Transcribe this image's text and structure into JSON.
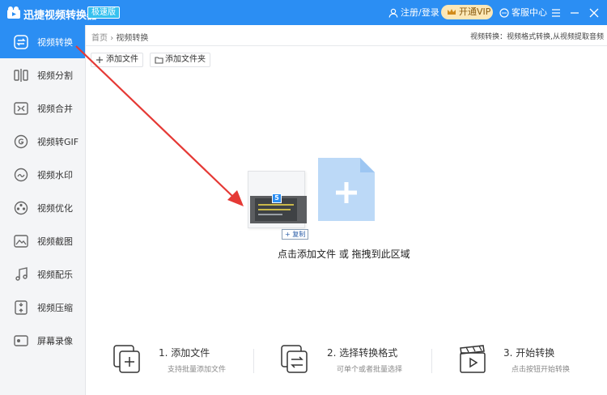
{
  "titlebar": {
    "app_title": "迅捷视频转换器",
    "badge": "极速版",
    "login": "注册/登录",
    "vip": "开通VIP",
    "service": "客服中心"
  },
  "sidebar": {
    "items": [
      {
        "label": "视频转换",
        "icon": "video-convert-icon"
      },
      {
        "label": "视频分割",
        "icon": "video-split-icon"
      },
      {
        "label": "视频合并",
        "icon": "video-merge-icon"
      },
      {
        "label": "视频转GIF",
        "icon": "video-to-gif-icon"
      },
      {
        "label": "视频水印",
        "icon": "video-watermark-icon"
      },
      {
        "label": "视频优化",
        "icon": "video-optimize-icon"
      },
      {
        "label": "视频截图",
        "icon": "video-screenshot-icon"
      },
      {
        "label": "视频配乐",
        "icon": "video-music-icon"
      },
      {
        "label": "视频压缩",
        "icon": "video-compress-icon"
      },
      {
        "label": "屏幕录像",
        "icon": "screen-record-icon"
      }
    ],
    "active_index": 0
  },
  "breadcrumb": {
    "home": "首页",
    "separator": "›",
    "current": "视频转换"
  },
  "hint": "视频转换：视频格式转换,从视频提取音频",
  "toolbar": {
    "add_file": "添加文件",
    "add_folder": "添加文件夹"
  },
  "dropzone": {
    "badge": "5",
    "copy_label": "+ 复制",
    "text": "点击添加文件 或 拖拽到此区域"
  },
  "steps": [
    {
      "title": "1. 添加文件",
      "desc": "支持批量添加文件"
    },
    {
      "title": "2. 选择转换格式",
      "desc": "可单个或者批量选择"
    },
    {
      "title": "3. 开始转换",
      "desc": "点击按钮开始转换"
    }
  ],
  "colors": {
    "accent": "#2b8ef3",
    "arrow": "#e53935",
    "vip_bg": "#fde7b6"
  }
}
